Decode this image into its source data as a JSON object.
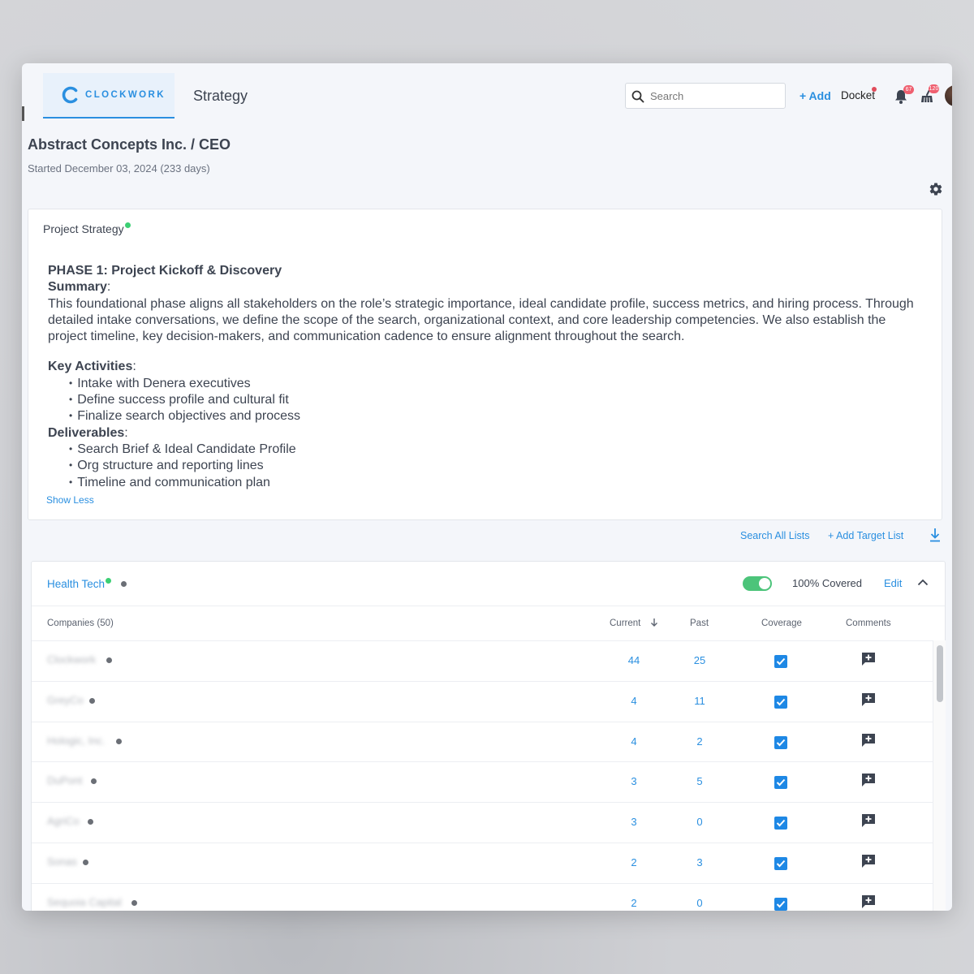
{
  "app": {
    "logo_text": "CLOCKWORK",
    "nav_title": "Strategy",
    "search_placeholder": "Search",
    "add_label": "+ Add",
    "docket_label": "Docket",
    "bell_count": "67",
    "broom_count": "120",
    "accent_color": "#2a8fe0"
  },
  "project": {
    "title": "Abstract Concepts Inc. / CEO",
    "started": "Started December 03, 2024 (233 days)"
  },
  "strategy": {
    "label": "Project Strategy",
    "phase_title": "PHASE 1: Project Kickoff & Discovery",
    "summary_label": "Summary",
    "summary_text": "This foundational phase aligns all stakeholders on the role’s strategic importance, ideal candidate profile, success metrics, and hiring process. Through detailed intake conversations, we define the scope of the search, organizational context, and core leadership competencies. We also establish the project timeline, key decision-makers, and communication cadence to ensure alignment throughout the search.",
    "activities_label": "Key Activities",
    "activities": [
      "Intake with Denera executives",
      "Define success profile and cultural fit",
      "Finalize search objectives and process"
    ],
    "deliverables_label": "Deliverables",
    "deliverables": [
      "Search Brief & Ideal Candidate Profile",
      "Org structure and reporting lines",
      "Timeline and communication plan"
    ],
    "show_less": "Show Less"
  },
  "lists": {
    "search_all": "Search All Lists",
    "add_target": "+ Add Target List"
  },
  "target_list": {
    "name": "Health Tech",
    "coverage_toggle_on": true,
    "covered_label": "100% Covered",
    "edit_label": "Edit",
    "columns": {
      "companies": "Companies (50)",
      "current": "Current",
      "past": "Past",
      "coverage": "Coverage",
      "comments": "Comments"
    },
    "rows": [
      {
        "company": "Clockwork",
        "current": "44",
        "past": "25",
        "covered": true
      },
      {
        "company": "GreyCo",
        "current": "4",
        "past": "11",
        "covered": true
      },
      {
        "company": "Hologic, Inc.",
        "current": "4",
        "past": "2",
        "covered": true
      },
      {
        "company": "DuPont",
        "current": "3",
        "past": "5",
        "covered": true
      },
      {
        "company": "AgriCo",
        "current": "3",
        "past": "0",
        "covered": true
      },
      {
        "company": "Sonas",
        "current": "2",
        "past": "3",
        "covered": true
      },
      {
        "company": "Sequoia Capital",
        "current": "2",
        "past": "0",
        "covered": true
      }
    ]
  }
}
